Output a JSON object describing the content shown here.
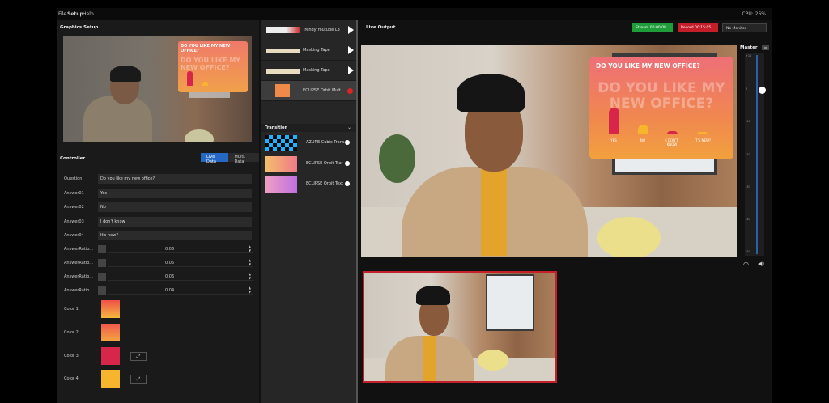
{
  "menu": {
    "file": "File",
    "setup": "Setup",
    "help": "Help",
    "cpu": "CPU: 26%"
  },
  "graphics_setup": {
    "title": "Graphics Setup",
    "preview_question": "DO YOU LIKE MY NEW OFFICE?",
    "preview_big": "DO YOU LIKE MY NEW OFFICE?"
  },
  "controller": {
    "title": "Controller",
    "tabs": [
      "Live Data",
      "Multi. Data"
    ],
    "fields": [
      {
        "label": "Question",
        "value": "Do you like my new office?"
      },
      {
        "label": "Answer01",
        "value": "Yes"
      },
      {
        "label": "Answer02",
        "value": "No"
      },
      {
        "label": "Answer03",
        "value": "I don't know"
      },
      {
        "label": "Answer04",
        "value": "It's new?"
      }
    ],
    "ratios": [
      {
        "label": "AnswerRatio...",
        "value": "0.06"
      },
      {
        "label": "AnswerRatio...",
        "value": "0.05"
      },
      {
        "label": "AnswerRatio...",
        "value": "0.06"
      },
      {
        "label": "AnswerRatio...",
        "value": "0.04"
      }
    ],
    "colors": [
      {
        "label": "Color 1",
        "top": "#f0504a",
        "bottom": "#f5b83c"
      },
      {
        "label": "Color 2",
        "top": "#ee5a4e",
        "bottom": "#f5a540"
      },
      {
        "label": "Color 3",
        "top": "#d8264a",
        "bottom": "#d8264a"
      },
      {
        "label": "Color 4",
        "top": "#f7b52e",
        "bottom": "#f7b52e"
      }
    ],
    "eyedrop_icon": "eyedropper-icon"
  },
  "graphics_list": [
    {
      "label": "Trendy Youtube L3"
    },
    {
      "label": "Masking Tape"
    },
    {
      "label": "Masking Tape"
    },
    {
      "label": "ECLIPSE Orbit Mult"
    }
  ],
  "transition": {
    "title": "Transition",
    "items": [
      {
        "label": "AZURE Cubic Trans"
      },
      {
        "label": "ECLIPSE Orbit Trar"
      },
      {
        "label": "ECLIPSE Orbit Text"
      }
    ]
  },
  "live_output": {
    "title": "Live Output",
    "stream": "Stream 00:00:08",
    "record": "Record 00:15:05",
    "monitor": "No Monitor",
    "card": {
      "question": "DO YOU LIKE MY NEW OFFICE?",
      "big": "DO YOU LIKE MY NEW OFFICE?",
      "answers": [
        "YES",
        "NO",
        "I DON'T KNOW",
        "IT'S NEW?"
      ]
    }
  },
  "master": {
    "label": "Master",
    "ticks": [
      "+10",
      "0",
      "-10",
      "-20",
      "-30",
      "-40",
      "-50"
    ]
  },
  "colors": {
    "accent": "#2569c4",
    "stream": "#1f9d3a",
    "record": "#c41e2a"
  }
}
